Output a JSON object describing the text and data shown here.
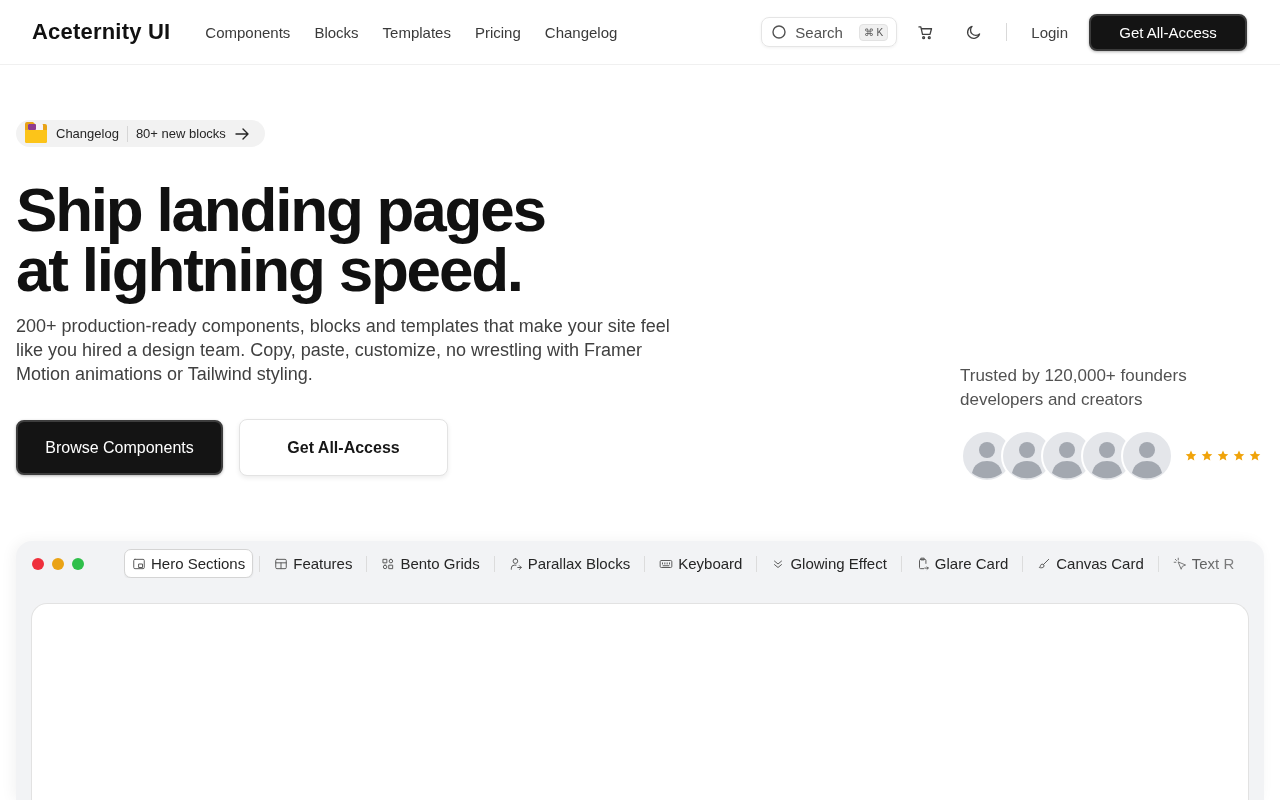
{
  "header": {
    "logo": "Aceternity UI",
    "nav": [
      {
        "label": "Components"
      },
      {
        "label": "Blocks"
      },
      {
        "label": "Templates"
      },
      {
        "label": "Pricing"
      },
      {
        "label": "Changelog"
      }
    ],
    "search": {
      "placeholder": "Search",
      "shortcut": "⌘ K"
    },
    "login": "Login",
    "cta": "Get All-Access"
  },
  "hero": {
    "announcement": {
      "tag": "Changelog",
      "text": "80+ new blocks"
    },
    "headline": "Ship landing pages\nat lightning speed.",
    "description": "200+ production-ready components, blocks and templates that make your site feel like you hired a design team. Copy, paste, customize, no wrestling with Framer Motion animations or Tailwind styling.",
    "buttons": [
      {
        "label": "Browse Components",
        "kind": "primary"
      },
      {
        "label": "Get All-Access",
        "kind": "secondary"
      }
    ],
    "social_proof": {
      "text": "Trusted by 120,000+ founders developers and creators",
      "avatars": [
        {
          "kind": "photo"
        },
        {
          "kind": "photo"
        },
        {
          "kind": "photo"
        },
        {
          "kind": "photo"
        },
        {
          "kind": "photo"
        }
      ],
      "rating": {
        "stars": 5
      }
    }
  },
  "preview": {
    "tabs": [
      {
        "label": "Hero Sections",
        "selected": true
      },
      {
        "label": "Features",
        "selected": false
      },
      {
        "label": "Bento Grids",
        "selected": false
      },
      {
        "label": "Parallax Blocks",
        "selected": false
      },
      {
        "label": "Keyboard",
        "selected": false
      },
      {
        "label": "Glowing Effect",
        "selected": false
      },
      {
        "label": "Glare Card",
        "selected": false
      },
      {
        "label": "Canvas Card",
        "selected": false
      },
      {
        "label": "Text R",
        "selected": false
      }
    ]
  }
}
